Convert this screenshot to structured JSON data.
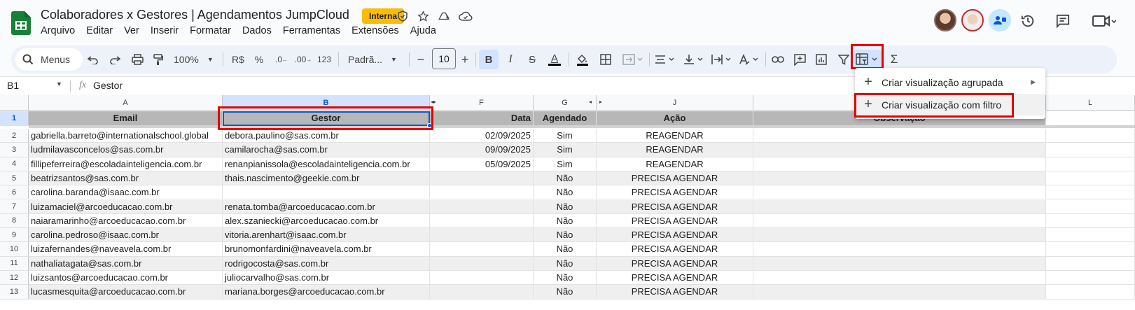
{
  "header": {
    "title": "Colaboradores x Gestores | Agendamentos JumpCloud",
    "badge": "Interna",
    "menu": [
      "Arquivo",
      "Editar",
      "Ver",
      "Inserir",
      "Formatar",
      "Dados",
      "Ferramentas",
      "Extensões",
      "Ajuda"
    ]
  },
  "toolbar": {
    "search_label": "Menus",
    "zoom": "100%",
    "currency": "R$",
    "percent": "%",
    "dec_less": ".0",
    "dec_more": ".00",
    "number_format": "123",
    "font": "Padrã...",
    "font_size": "10",
    "sigma": "Σ"
  },
  "formula_bar": {
    "cell_ref": "B1",
    "fx": "fx",
    "content": "Gestor"
  },
  "columns": [
    "A",
    "B",
    "F",
    "G",
    "J",
    "L"
  ],
  "rows": [
    "1",
    "2",
    "3",
    "4",
    "5",
    "6",
    "7",
    "8",
    "9",
    "10",
    "11",
    "12",
    "13"
  ],
  "table": {
    "headers": [
      "Email",
      "Gestor",
      "Data",
      "Agendado",
      "Ação",
      "Observação"
    ],
    "data": [
      [
        "gabriella.barreto@internationalschool.global",
        "debora.paulino@sas.com.br",
        "02/09/2025",
        "Sim",
        "REAGENDAR"
      ],
      [
        "ludmilavasconcelos@sas.com.br",
        "camilarocha@sas.com.br",
        "09/09/2025",
        "Sim",
        "REAGENDAR"
      ],
      [
        "fillipeferreira@escoladainteligencia.com.br",
        "renanpianissola@escoladainteligencia.com.br",
        "05/09/2025",
        "Sim",
        "REAGENDAR"
      ],
      [
        "beatrizsantos@sas.com.br",
        "thais.nascimento@geekie.com.br",
        "",
        "Não",
        "PRECISA AGENDAR"
      ],
      [
        "carolina.baranda@isaac.com.br",
        "",
        "",
        "Não",
        "PRECISA AGENDAR"
      ],
      [
        "luizamaciel@arcoeducacao.com.br",
        "renata.tomba@arcoeducacao.com.br",
        "",
        "Não",
        "PRECISA AGENDAR"
      ],
      [
        "naiaramarinho@arcoeducacao.com.br",
        "alex.szaniecki@arcoeducacao.com.br",
        "",
        "Não",
        "PRECISA AGENDAR"
      ],
      [
        "carolina.pedroso@isaac.com.br",
        "vitoria.arenhart@isaac.com.br",
        "",
        "Não",
        "PRECISA AGENDAR"
      ],
      [
        "luizafernandes@naveavela.com.br",
        "brunomonfardini@naveavela.com.br",
        "",
        "Não",
        "PRECISA AGENDAR"
      ],
      [
        "nathaliatagata@sas.com.br",
        "rodrigocosta@sas.com.br",
        "",
        "Não",
        "PRECISA AGENDAR"
      ],
      [
        "luizsantos@arcoeducacao.com.br",
        "juliocarvalho@sas.com.br",
        "",
        "Não",
        "PRECISA AGENDAR"
      ],
      [
        "lucasmesquita@arcoeducacao.com.br",
        "mariana.borges@arcoeducacao.com.br",
        "",
        "Não",
        "PRECISA AGENDAR"
      ]
    ]
  },
  "dropdown": {
    "items": [
      "Criar visualização agrupada",
      "Criar visualização com filtro"
    ]
  },
  "colors": {
    "accent": "#0b57d0",
    "highlight": "#e60000",
    "badge": "#fbbc04",
    "sheets_green": "#188038"
  }
}
